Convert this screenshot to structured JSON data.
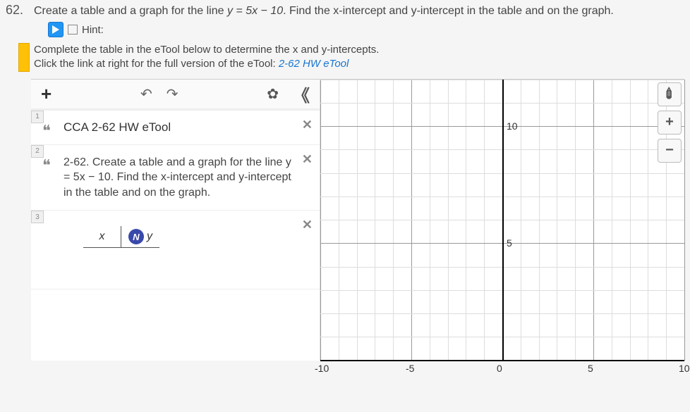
{
  "question": {
    "number": "62.",
    "text_before": "Create a table and a graph for the line ",
    "equation": "y = 5x − 10",
    "text_after": ". Find the x-intercept and y-intercept in the table and on the graph."
  },
  "hint": {
    "label": "Hint:"
  },
  "instructions": {
    "line1": "Complete the table in the eTool below to determine the x and y-intercepts.",
    "line2_prefix": "Click the link at right for the full version of the eTool: ",
    "link_text": "2-62 HW eTool"
  },
  "toolbar": {
    "add": "+",
    "undo": "↶",
    "redo": "↷",
    "settings": "✿",
    "collapse": "《"
  },
  "cards": {
    "c1": {
      "num": "1",
      "title": "CCA 2-62 HW eTool"
    },
    "c2": {
      "num": "2",
      "body": "2-62. Create a table and a graph for the line y = 5x − 10. Find the x-intercept and y-intercept in the table and on the graph."
    },
    "c3": {
      "num": "3",
      "col_x": "x",
      "col_y": "y",
      "n_badge": "N"
    }
  },
  "graph": {
    "x_ticks": {
      "n10": "-10",
      "n5": "-5",
      "zero": "0",
      "p5": "5",
      "p10": "10"
    },
    "y_ticks": {
      "p10": "10",
      "p5": "5"
    }
  },
  "right_controls": {
    "wrench": "✐",
    "plus": "+",
    "minus": "−"
  },
  "chart_data": {
    "type": "scatter",
    "title": "",
    "xlabel": "",
    "ylabel": "",
    "xlim": [
      -10,
      10
    ],
    "ylim": [
      0,
      12
    ],
    "x_ticks": [
      -10,
      -5,
      0,
      5,
      10
    ],
    "y_ticks": [
      5,
      10
    ],
    "grid": true,
    "series": []
  }
}
